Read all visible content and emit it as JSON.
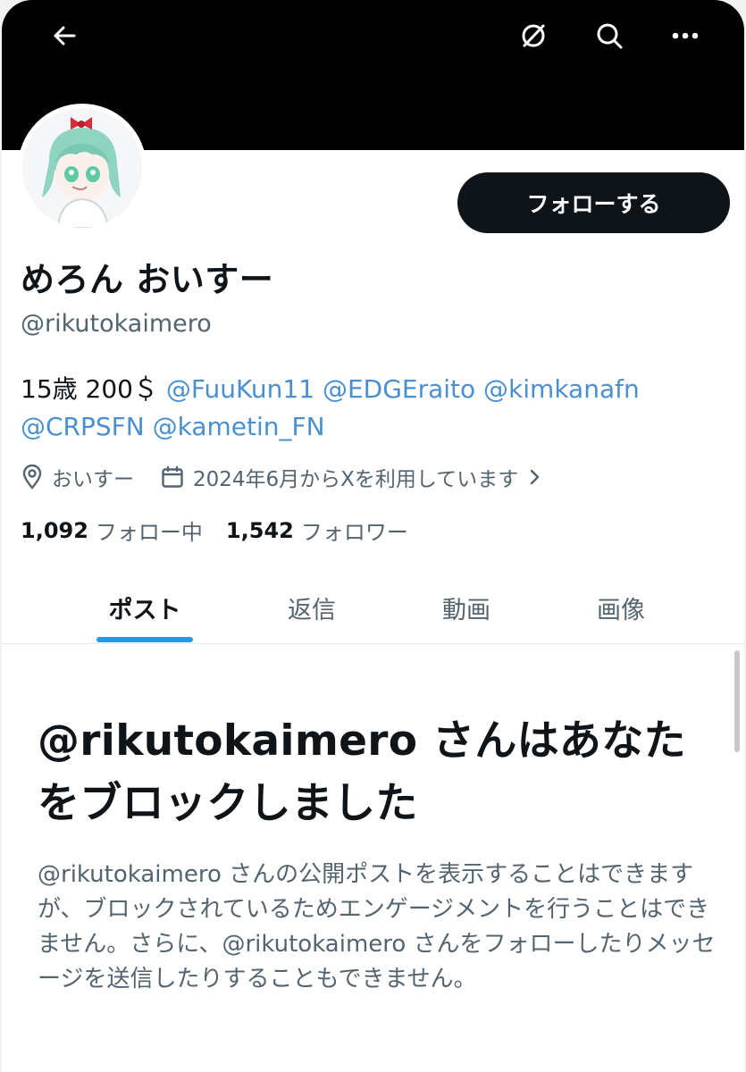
{
  "profile": {
    "display_name": "めろん おいすー",
    "handle": "@rikutokaimero",
    "follow_label": "フォローする",
    "bio_prefix": "15歳 200＄ ",
    "bio_mentions": [
      "@FuuKun11",
      "@EDGEraito",
      "@kimkanafn",
      "@CRPSFN",
      "@kametin_FN"
    ],
    "location": "おいすー",
    "joined": "2024年6月からXを利用しています",
    "following_count": "1,092",
    "following_label": "フォロー中",
    "followers_count": "1,542",
    "followers_label": "フォロワー"
  },
  "header": {
    "icons": [
      "back-arrow-icon",
      "grok-icon",
      "search-icon",
      "more-icon"
    ]
  },
  "tabs": [
    {
      "label": "ポスト",
      "active": true
    },
    {
      "label": "返信",
      "active": false
    },
    {
      "label": "動画",
      "active": false
    },
    {
      "label": "画像",
      "active": false
    }
  ],
  "blocked": {
    "title": "@rikutokaimero さんはあなたをブロックしました",
    "body": "@rikutokaimero さんの公開ポストを表示することはできますが、ブロックされているためエンゲージメントを行うことはできません。さらに、@rikutokaimero さんをフォローしたりメッセージを送信したりすることもできません。"
  },
  "colors": {
    "accent": "#1d9bf0",
    "text": "#0f1419",
    "muted": "#536471",
    "banner": "#000000"
  }
}
